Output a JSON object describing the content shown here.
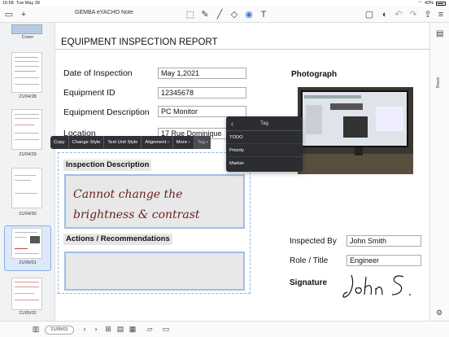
{
  "status": {
    "time": "15:58",
    "date": "Tue May 28",
    "battery": "43%"
  },
  "app": {
    "title": "GEMBA eYACHO Note"
  },
  "toolbar_icons": [
    "folder-icon",
    "plus-icon",
    "lasso-icon",
    "pen-icon",
    "marker-icon",
    "eraser-icon",
    "stamp-icon",
    "text-icon",
    "shape-icon",
    "mic-icon",
    "undo-icon",
    "redo-icon",
    "share-icon",
    "more-icon"
  ],
  "toolbar_labels": {
    "undo": "Undo",
    "redo": "Redo"
  },
  "sidebar": {
    "pages": [
      {
        "label": "Cover"
      },
      {
        "label": "21/04/28"
      },
      {
        "label": "21/04/29"
      },
      {
        "label": "21/04/30"
      },
      {
        "label": "21/05/01",
        "selected": true
      },
      {
        "label": "21/05/02"
      }
    ]
  },
  "rail": {
    "tab": "Basic"
  },
  "document": {
    "title": "EQUIPMENT INSPECTION REPORT",
    "fields": [
      {
        "label": "Date of Inspection",
        "value": "May 1,2021"
      },
      {
        "label": "Equipment ID",
        "value": "12345678"
      },
      {
        "label": "Equipment Description",
        "value": "PC Monitor"
      },
      {
        "label": "Location",
        "value": "17 Rue Dominique"
      }
    ],
    "photo_label": "Photograph",
    "inspection_header": "Inspection Description",
    "inspection_handwriting": [
      "Cannot change the",
      "brightness & contrast"
    ],
    "actions_header": "Actions / Recommendations",
    "inspected_by_label": "Inspected By",
    "inspected_by_value": "John Smith",
    "role_label": "Role / Title",
    "role_value": "Engineer",
    "signature_label": "Signature",
    "signature_text": "John S."
  },
  "context_bar": {
    "items": [
      "Copy",
      "Change Style",
      "Text Unit Style",
      "Alignment",
      "More",
      "Tag"
    ]
  },
  "tag_popup": {
    "title": "Tag",
    "options": [
      "TODO",
      "Priority",
      "Marker"
    ]
  },
  "bottombar": {
    "page": "21/05/01"
  },
  "colors": {
    "accent": "#3d7bd9",
    "selection_border": "#9dbfe8",
    "popup_bg": "#2b2d31"
  }
}
